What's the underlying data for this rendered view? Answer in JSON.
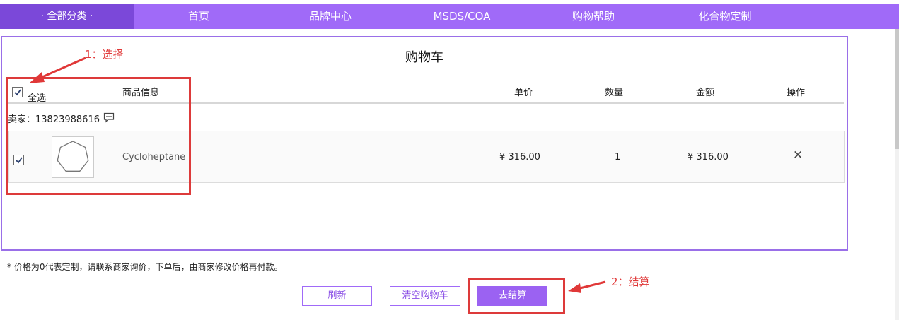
{
  "nav": {
    "all_categories": "· 全部分类 ·",
    "items": [
      "首页",
      "品牌中心",
      "MSDS/COA",
      "购物帮助",
      "化合物定制"
    ]
  },
  "cart": {
    "title": "购物车",
    "select_all_label": "全选",
    "select_all_checked": true,
    "columns": {
      "product_info": "商品信息",
      "unit_price": "单价",
      "quantity": "数量",
      "amount": "金额",
      "action": "操作"
    },
    "seller": "卖家：13823988616",
    "items": [
      {
        "checked": true,
        "name": "Cycloheptane",
        "unit_price": "¥ 316.00",
        "quantity": "1",
        "amount": "¥ 316.00",
        "remove": "✕"
      }
    ]
  },
  "note": "* 价格为0代表定制，请联系商家询价，下单后，由商家修改价格再付款。",
  "buttons": {
    "refresh": "刷新",
    "clear_cart": "清空购物车",
    "checkout": "去结算"
  },
  "annotations": {
    "step1": "1：选择",
    "step2": "2：结算"
  },
  "colors": {
    "nav_bg": "#a06af8",
    "nav_active": "#7b48d9",
    "panel_border": "#9a6fe8",
    "primary_button": "#9b62f2",
    "annotation_red": "#e03838"
  },
  "icons": {
    "check": "checkmark-icon",
    "chat": "chat-bubble-icon",
    "remove": "close-icon"
  }
}
